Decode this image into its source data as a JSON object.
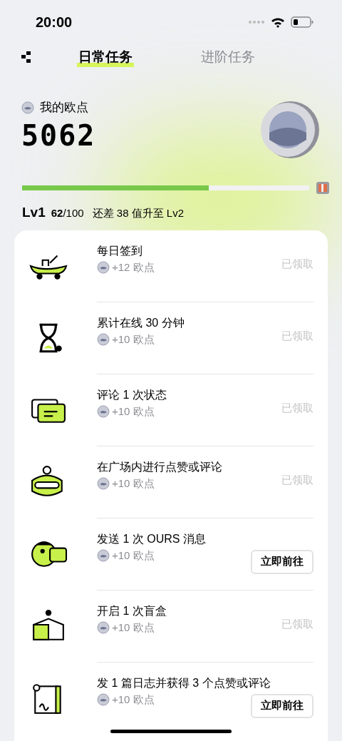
{
  "status_bar": {
    "time": "20:00"
  },
  "tabs": [
    {
      "label": "日常任务",
      "selected": true
    },
    {
      "label": "进阶任务",
      "selected": false
    }
  ],
  "points": {
    "label": "我的欧点",
    "value": "5062"
  },
  "level": {
    "level": 0.65,
    "name": "Lv1",
    "progress": "**62**/100",
    "hint": "还差 38 值升至 Lv2"
  },
  "tasks": [
    {
      "title": "每日签到",
      "reward": "+12 欧点",
      "kind": "done",
      "action": "已领取"
    },
    {
      "title": "累计在线 30 分钟",
      "reward": "+10 欧点",
      "kind": "done",
      "action": "已领取"
    },
    {
      "title": "评论 1 次状态",
      "reward": "+10 欧点",
      "kind": "done",
      "action": "已领取"
    },
    {
      "title": "在广场内进行点赞或评论",
      "reward": "+10 欧点",
      "kind": "done",
      "action": "已领取"
    },
    {
      "title": "发送 1 次 OURS 消息",
      "reward": "+10 欧点",
      "kind": "go",
      "action": "立即前往"
    },
    {
      "title": "开启 1 次盲盒",
      "reward": "+10 欧点",
      "kind": "done",
      "action": "已领取"
    },
    {
      "title": "发 1 篇日志并获得 3 个点赞或评论",
      "reward": "+10 欧点",
      "kind": "go",
      "action": "立即前往"
    }
  ]
}
